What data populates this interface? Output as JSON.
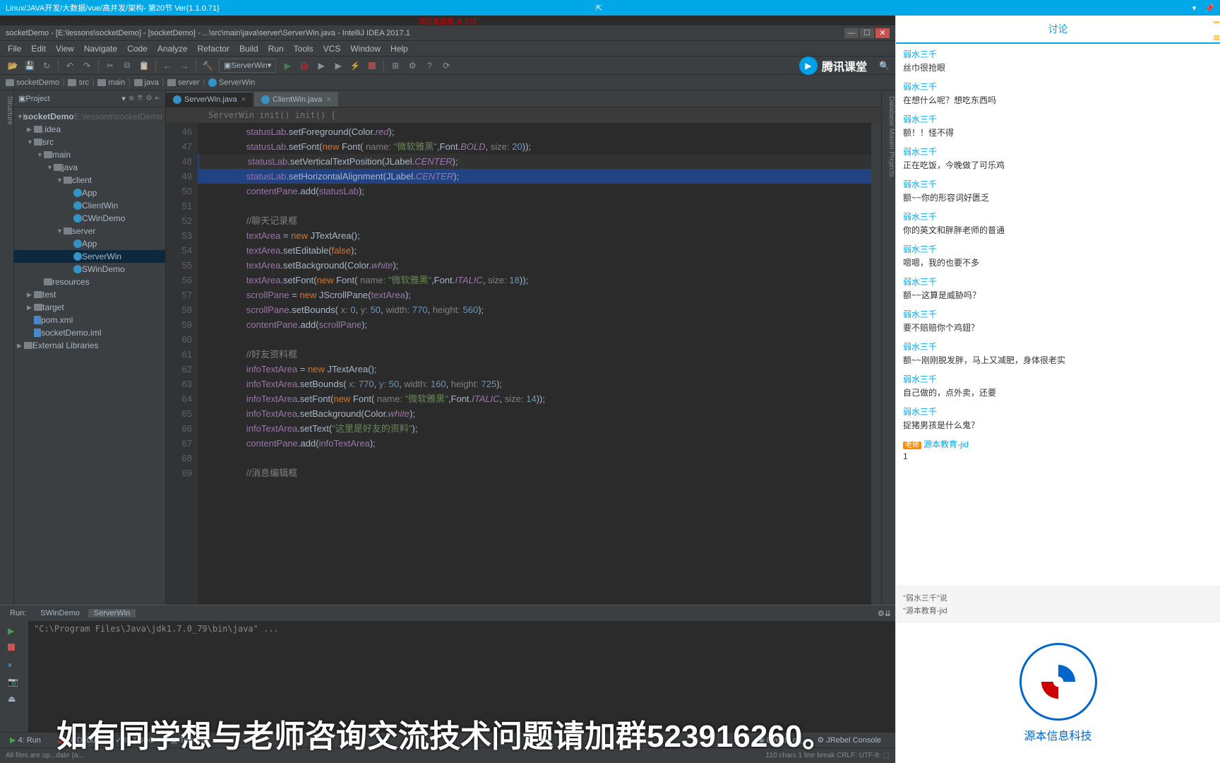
{
  "topbar": {
    "title": "Linux/JAVA开发/大数据/vue/高并发/架构- 第20节 Ver{1.1.0.71}"
  },
  "ide": {
    "redBanner": "请观看直播 未上线",
    "windowTitle": "socketDemo - [E:\\lessons\\socketDemo] - [socketDemo] - ...\\src\\main\\java\\server\\ServerWin.java - IntelliJ IDEA 2017.1",
    "menu": [
      "File",
      "Edit",
      "View",
      "Navigate",
      "Code",
      "Analyze",
      "Refactor",
      "Build",
      "Run",
      "Tools",
      "VCS",
      "Window",
      "Help"
    ],
    "runConfig": "ServerWin",
    "logo": "腾讯课堂",
    "breadcrumb": [
      "socketDemo",
      "src",
      "main",
      "java",
      "server",
      "ServerWin"
    ],
    "projectLabel": "Project",
    "tree": [
      {
        "lvl": 0,
        "arrow": "▼",
        "icon": "folder",
        "text": "socketDemo",
        "extra": " E:\\lessons\\socketDemo",
        "bold": true
      },
      {
        "lvl": 1,
        "arrow": "▶",
        "icon": "folder",
        "text": ".idea"
      },
      {
        "lvl": 1,
        "arrow": "▼",
        "icon": "folder",
        "text": "src"
      },
      {
        "lvl": 2,
        "arrow": "▼",
        "icon": "folder",
        "text": "main"
      },
      {
        "lvl": 3,
        "arrow": "▼",
        "icon": "folder",
        "text": "java"
      },
      {
        "lvl": 4,
        "arrow": "▼",
        "icon": "folder",
        "text": "client"
      },
      {
        "lvl": 5,
        "arrow": "",
        "icon": "java",
        "text": "App"
      },
      {
        "lvl": 5,
        "arrow": "",
        "icon": "java",
        "text": "ClientWin"
      },
      {
        "lvl": 5,
        "arrow": "",
        "icon": "java",
        "text": "CWinDemo"
      },
      {
        "lvl": 4,
        "arrow": "▼",
        "icon": "folder",
        "text": "server"
      },
      {
        "lvl": 5,
        "arrow": "",
        "icon": "java",
        "text": "App"
      },
      {
        "lvl": 5,
        "arrow": "",
        "icon": "java",
        "text": "ServerWin",
        "sel": true
      },
      {
        "lvl": 5,
        "arrow": "",
        "icon": "java",
        "text": "SWinDemo"
      },
      {
        "lvl": 2,
        "arrow": "",
        "icon": "folder",
        "text": "resources"
      },
      {
        "lvl": 1,
        "arrow": "▶",
        "icon": "folder",
        "text": "test"
      },
      {
        "lvl": 1,
        "arrow": "▶",
        "icon": "folder",
        "text": "target"
      },
      {
        "lvl": 1,
        "arrow": "",
        "icon": "file",
        "text": "pom.xml"
      },
      {
        "lvl": 1,
        "arrow": "",
        "icon": "file",
        "text": "socketDemo.iml"
      },
      {
        "lvl": 0,
        "arrow": "▶",
        "icon": "folder",
        "text": "External Libraries"
      }
    ],
    "tabs": [
      {
        "label": "ServerWin.java",
        "active": true
      },
      {
        "label": "ClientWin.java",
        "active": false
      }
    ],
    "contextLine": "ServerWin  init()  init() {",
    "code": {
      "startLine": 46,
      "lines": [
        {
          "n": 46,
          "html": "        <span class='tok-field'>statusLab</span>.setForeground(Color.<span class='tok-const'>red</span>);"
        },
        {
          "n": 47,
          "html": "        <span class='tok-field'>statusLab</span>.setFont(<span class='tok-kw'>new</span> Font( <span class='tok-param'>name:</span> <span class='tok-str'>\"微软雅黑\"</span>,Font.<span class='tok-const'>BOLD</span>, <span class='tok-param'>size:</span> <span class='tok-num'>20</span>));"
        },
        {
          "n": 48,
          "hl": true,
          "html": "        <span class='tok-field'>statusLab</span>.setVerticalTextPosition(JLabel.<span class='tok-const'>CENTER</span>);"
        },
        {
          "n": 49,
          "sel": true,
          "html": "        <span class='tok-field'>statusLab</span>.setHorizontalAlignment(JLabel.<span class='tok-const'>CENTER</span>);"
        },
        {
          "n": 50,
          "html": "        <span class='tok-field'>contentPane</span>.add(<span class='tok-field'>statusLab</span>);"
        },
        {
          "n": 51,
          "html": ""
        },
        {
          "n": 52,
          "html": "        <span class='tok-comment'>//聊天记录框</span>"
        },
        {
          "n": 53,
          "html": "        <span class='tok-field'>textArea</span> = <span class='tok-kw'>new</span> JTextArea();"
        },
        {
          "n": 54,
          "html": "        <span class='tok-field'>textArea</span>.setEditable(<span class='tok-kw'>false</span>);"
        },
        {
          "n": 55,
          "html": "        <span class='tok-field'>textArea</span>.setBackground(Color.<span class='tok-const'>white</span>);"
        },
        {
          "n": 56,
          "html": "        <span class='tok-field'>textArea</span>.setFont(<span class='tok-kw'>new</span> Font( <span class='tok-param'>name:</span> <span class='tok-str'>\"微软雅黑\"</span>,Font.<span class='tok-const'>ITALIC</span>, <span class='tok-param'>size:</span> <span class='tok-num'>18</span>));"
        },
        {
          "n": 57,
          "html": "        <span class='tok-field'>scrollPane</span> = <span class='tok-kw'>new</span> JScrollPane(<span class='tok-field'>textArea</span>);"
        },
        {
          "n": 58,
          "html": "        <span class='tok-field'>scrollPane</span>.setBounds( <span class='tok-param'>x:</span> <span class='tok-num'>0</span>, <span class='tok-param'>y:</span> <span class='tok-num'>50</span>, <span class='tok-param'>width:</span> <span class='tok-num'>770</span>, <span class='tok-param'>height:</span> <span class='tok-num'>560</span>);"
        },
        {
          "n": 59,
          "html": "        <span class='tok-field'>contentPane</span>.add(<span class='tok-field'>scrollPane</span>);"
        },
        {
          "n": 60,
          "html": ""
        },
        {
          "n": 61,
          "html": "        <span class='tok-comment'>//好友资料框</span>"
        },
        {
          "n": 62,
          "html": "        <span class='tok-field'>infoTextArea</span> = <span class='tok-kw'>new</span> JTextArea();"
        },
        {
          "n": 63,
          "html": "        <span class='tok-field'>infoTextArea</span>.setBounds( <span class='tok-param'>x:</span> <span class='tok-num'>770</span>, <span class='tok-param'>y:</span> <span class='tok-num'>50</span>, <span class='tok-param'>width:</span> <span class='tok-num'>160</span>, <span class='tok-param'>height:</span> <span class='tok-num'>725</span>);"
        },
        {
          "n": 64,
          "html": "        <span class='tok-field'>infoTextArea</span>.setFont(<span class='tok-kw'>new</span> Font( <span class='tok-param'>name:</span> <span class='tok-str'>\"微软雅黑\"</span>,Font.<span class='tok-const'>ITALIC</span>, <span class='tok-param'>size:</span> <span class='tok-num'>14</span>));"
        },
        {
          "n": 65,
          "html": "        <span class='tok-field'>infoTextArea</span>.setBackground(Color.<span class='tok-const'>white</span>);"
        },
        {
          "n": 66,
          "html": "        <span class='tok-field'>infoTextArea</span>.setText(<span class='tok-str'>\"这里是好友的资料\"</span>);"
        },
        {
          "n": 67,
          "html": "        <span class='tok-field'>contentPane</span>.add(<span class='tok-field'>infoTextArea</span>);"
        },
        {
          "n": 68,
          "html": ""
        },
        {
          "n": 69,
          "html": "        <span class='tok-comment'>//消息编辑框</span>"
        }
      ]
    },
    "runTabs": {
      "run": "Run:",
      "items": [
        "SWinDemo",
        "ServerWin"
      ]
    },
    "runOutput": "\"C:\\Program Files\\Java\\jdk1.7.0_79\\bin\\java\" ...",
    "bottomTabs": {
      "run": "4: Run",
      "debug": "5: Debug",
      "todo": "6: TODO",
      "terminal": "Terminal",
      "eventLog": "Event Log",
      "jrebel": "JRebel Console"
    },
    "statusBar": {
      "left": "All files are up...date (a...",
      "right": "110 chars  1 line break   CRLF:  UTF-8:  ⬚  "
    }
  },
  "chat": {
    "tab": "讨论",
    "messages": [
      {
        "user": "弱水三千",
        "text": "丝巾很抢眼"
      },
      {
        "user": "弱水三千",
        "text": "在想什么呢？想吃东西吗"
      },
      {
        "user": "弱水三千",
        "text": "额！！怪不得"
      },
      {
        "user": "弱水三千",
        "text": "正在吃饭，今晚做了可乐鸡"
      },
      {
        "user": "弱水三千",
        "text": "额~~你的形容词好匮乏"
      },
      {
        "user": "弱水三千",
        "text": "你的英文和胖胖老师的普通"
      },
      {
        "user": "弱水三千",
        "text": "嗯嗯，我的也要不多"
      },
      {
        "user": "弱水三千",
        "text": "额~~这算是威胁吗？"
      },
      {
        "user": "弱水三千",
        "text": "要不赔赔你个鸡翅？"
      },
      {
        "user": "弱水三千",
        "text": "额~~刚刚脱发胖，马上又减肥，身体很老实"
      },
      {
        "user": "弱水三千",
        "text": "自己做的，点外卖，还要"
      },
      {
        "user": "弱水三千",
        "text": "捉猪男孩是什么鬼？"
      },
      {
        "user": "源本教育-jid",
        "text": "1",
        "badge": "老师"
      }
    ],
    "quotes": [
      "\"弱水三千\"说",
      "\"源本教育-jid"
    ],
    "org": "源本信息科技"
  },
  "caption": "如有同学想与老师咨询交流技术问题请加群523916260。"
}
